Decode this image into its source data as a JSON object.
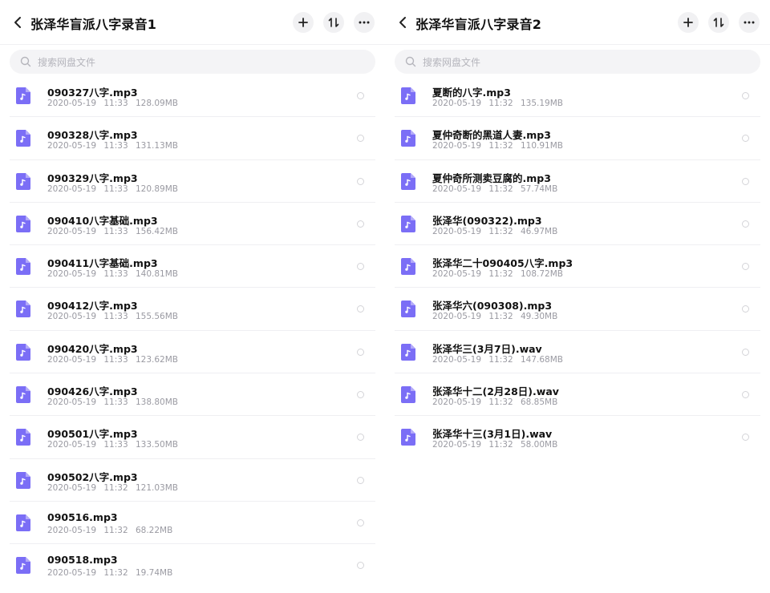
{
  "icons": {
    "back": "chevron-left-icon",
    "add": "plus-icon",
    "sort": "sort-icon",
    "more": "more-icon",
    "search": "search-icon",
    "file": "audio-file-icon"
  },
  "colors": {
    "file_icon": "#7b6ef6",
    "accent_bg": "#f1f1f3",
    "meta_text": "#9a9aa2"
  },
  "panels": [
    {
      "title": "张泽华盲派八字录音1",
      "search_placeholder": "搜索网盘文件",
      "files": [
        {
          "name": "090327八字.mp3",
          "date": "2020-05-19",
          "time": "11:33",
          "size": "128.09MB"
        },
        {
          "name": "090328八字.mp3",
          "date": "2020-05-19",
          "time": "11:33",
          "size": "131.13MB"
        },
        {
          "name": "090329八字.mp3",
          "date": "2020-05-19",
          "time": "11:33",
          "size": "120.89MB"
        },
        {
          "name": "090410八字基础.mp3",
          "date": "2020-05-19",
          "time": "11:33",
          "size": "156.42MB"
        },
        {
          "name": "090411八字基础.mp3",
          "date": "2020-05-19",
          "time": "11:33",
          "size": "140.81MB"
        },
        {
          "name": "090412八字.mp3",
          "date": "2020-05-19",
          "time": "11:33",
          "size": "155.56MB"
        },
        {
          "name": "090420八字.mp3",
          "date": "2020-05-19",
          "time": "11:33",
          "size": "123.62MB"
        },
        {
          "name": "090426八字.mp3",
          "date": "2020-05-19",
          "time": "11:33",
          "size": "138.80MB"
        },
        {
          "name": "090501八字.mp3",
          "date": "2020-05-19",
          "time": "11:33",
          "size": "133.50MB"
        },
        {
          "name": "090502八字.mp3",
          "date": "2020-05-19",
          "time": "11:32",
          "size": "121.03MB"
        },
        {
          "name": "090516.mp3",
          "date": "2020-05-19",
          "time": "11:32",
          "size": "68.22MB"
        },
        {
          "name": "090518.mp3",
          "date": "2020-05-19",
          "time": "11:32",
          "size": "19.74MB"
        }
      ]
    },
    {
      "title": "张泽华盲派八字录音2",
      "search_placeholder": "搜索网盘文件",
      "files": [
        {
          "name": "夏断的八字.mp3",
          "date": "2020-05-19",
          "time": "11:32",
          "size": "135.19MB"
        },
        {
          "name": "夏仲奇断的黑道人妻.mp3",
          "date": "2020-05-19",
          "time": "11:32",
          "size": "110.91MB"
        },
        {
          "name": "夏仲奇所测卖豆腐的.mp3",
          "date": "2020-05-19",
          "time": "11:32",
          "size": "57.74MB"
        },
        {
          "name": "张泽华(090322).mp3",
          "date": "2020-05-19",
          "time": "11:32",
          "size": "46.97MB"
        },
        {
          "name": "张泽华二十090405八字.mp3",
          "date": "2020-05-19",
          "time": "11:32",
          "size": "108.72MB"
        },
        {
          "name": "张泽华六(090308).mp3",
          "date": "2020-05-19",
          "time": "11:32",
          "size": "49.30MB"
        },
        {
          "name": "张泽华三(3月7日).wav",
          "date": "2020-05-19",
          "time": "11:32",
          "size": "147.68MB"
        },
        {
          "name": "张泽华十二(2月28日).wav",
          "date": "2020-05-19",
          "time": "11:32",
          "size": "68.85MB"
        },
        {
          "name": "张泽华十三(3月1日).wav",
          "date": "2020-05-19",
          "time": "11:32",
          "size": "58.00MB"
        }
      ]
    }
  ]
}
